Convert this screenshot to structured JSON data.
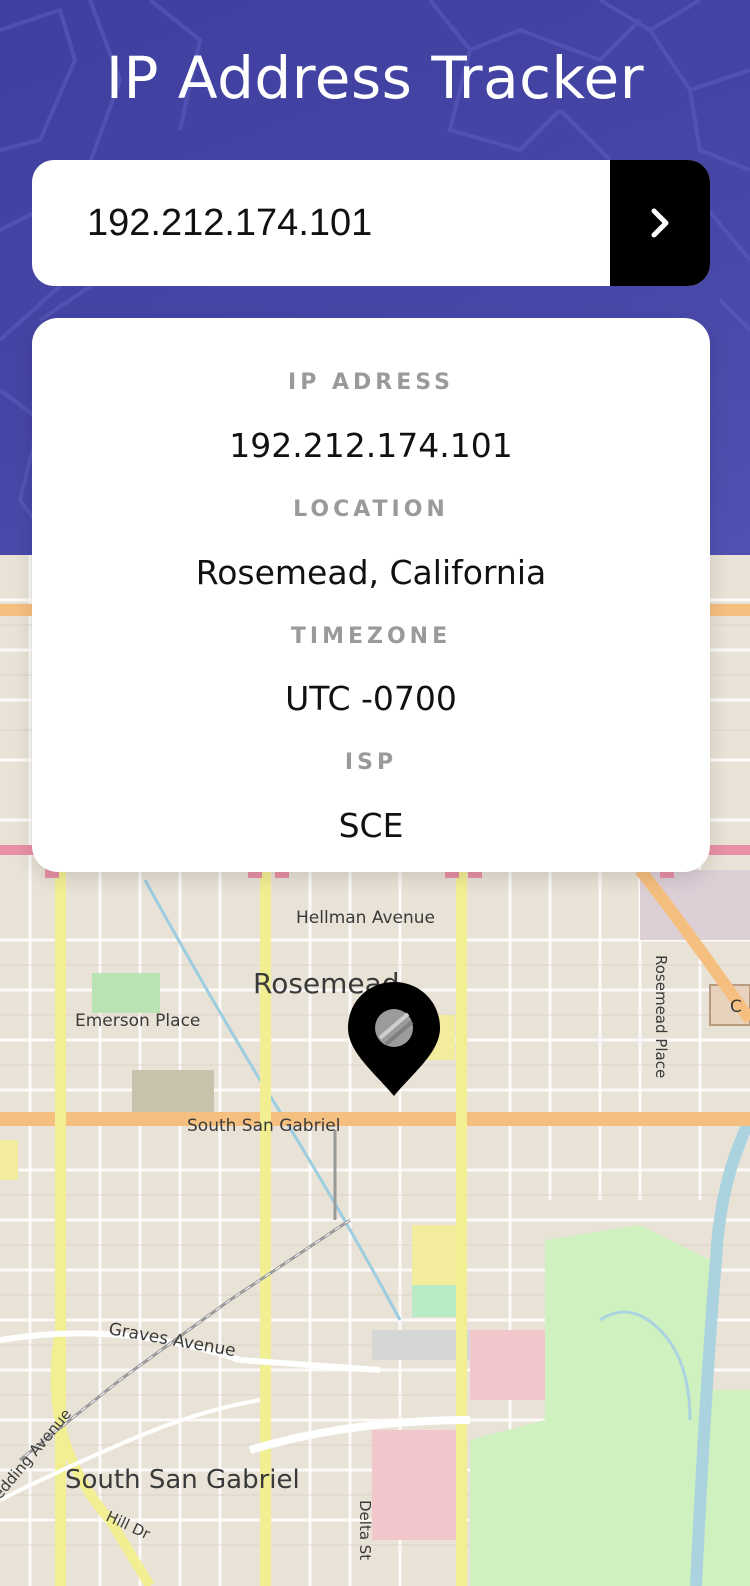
{
  "header": {
    "title": "IP Address Tracker"
  },
  "search": {
    "value": "192.212.174.101",
    "button_icon": "chevron-right-icon"
  },
  "info": {
    "ip_label": "IP ADRESS",
    "ip_value": "192.212.174.101",
    "location_label": "LOCATION",
    "location_value": "Rosemead, California",
    "timezone_label": "TIMEZONE",
    "timezone_value": "UTC -0700",
    "isp_label": "ISP",
    "isp_value": "SCE"
  },
  "map": {
    "labels": {
      "hellman": "Hellman Avenue",
      "rosemead": "Rosemead",
      "emerson": "Emerson Place",
      "rosemead_place": "Rosemead Place",
      "south_san_gabriel_road": "South San Gabriel",
      "graves": "Graves Avenue",
      "south_san_gabriel_area": "South San Gabriel",
      "delta": "Delta St",
      "hill": "Hill Dr",
      "wedding": "edding Avenue",
      "cut_c": "C"
    },
    "marker_icon": "location-pin-icon"
  },
  "colors": {
    "header_bg": "#4646a6",
    "card_bg": "#ffffff",
    "label": "#9a9a9a",
    "button_bg": "#000000"
  }
}
